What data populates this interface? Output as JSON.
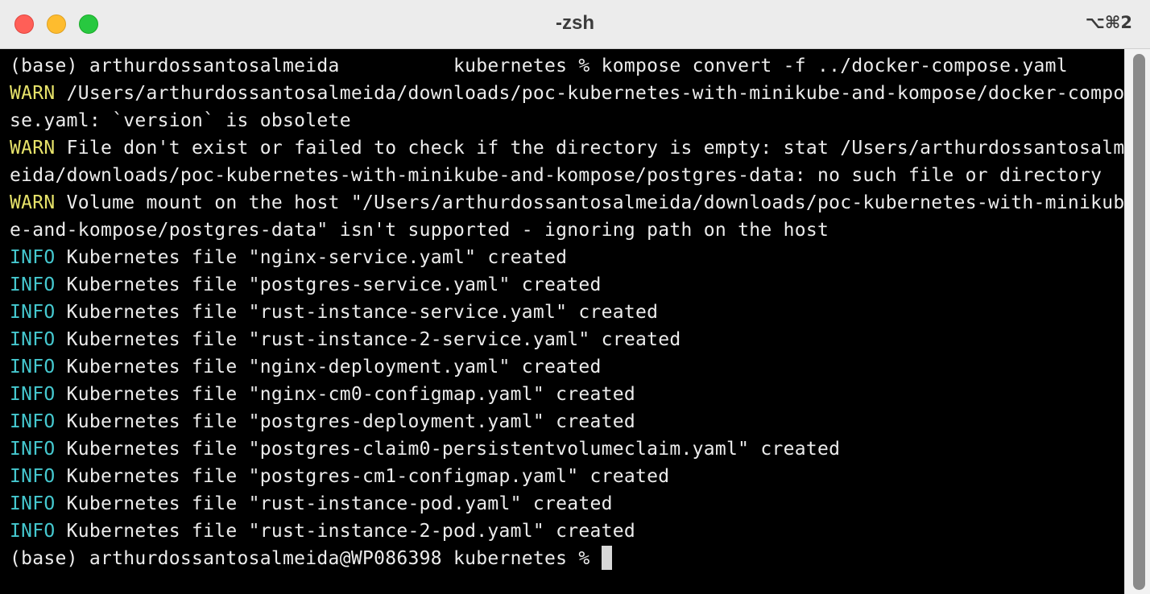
{
  "window": {
    "title": "-zsh",
    "shortcut": "⌥⌘2"
  },
  "terminal": {
    "lines": [
      {
        "tag": "",
        "text": "(base) arthurdossantosalmeida          kubernetes % kompose convert -f ../docker-compose.yaml"
      },
      {
        "tag": "WARN",
        "text": " /Users/arthurdossantosalmeida/downloads/poc-kubernetes-with-minikube-and-kompose/docker-compo"
      },
      {
        "tag": "",
        "text": "se.yaml: `version` is obsolete"
      },
      {
        "tag": "WARN",
        "text": " File don't exist or failed to check if the directory is empty: stat /Users/arthurdossantosalm"
      },
      {
        "tag": "",
        "text": "eida/downloads/poc-kubernetes-with-minikube-and-kompose/postgres-data: no such file or directory"
      },
      {
        "tag": "WARN",
        "text": " Volume mount on the host \"/Users/arthurdossantosalmeida/downloads/poc-kubernetes-with-minikub"
      },
      {
        "tag": "",
        "text": "e-and-kompose/postgres-data\" isn't supported - ignoring path on the host"
      },
      {
        "tag": "INFO",
        "text": " Kubernetes file \"nginx-service.yaml\" created"
      },
      {
        "tag": "INFO",
        "text": " Kubernetes file \"postgres-service.yaml\" created"
      },
      {
        "tag": "INFO",
        "text": " Kubernetes file \"rust-instance-service.yaml\" created"
      },
      {
        "tag": "INFO",
        "text": " Kubernetes file \"rust-instance-2-service.yaml\" created"
      },
      {
        "tag": "INFO",
        "text": " Kubernetes file \"nginx-deployment.yaml\" created"
      },
      {
        "tag": "INFO",
        "text": " Kubernetes file \"nginx-cm0-configmap.yaml\" created"
      },
      {
        "tag": "INFO",
        "text": " Kubernetes file \"postgres-deployment.yaml\" created"
      },
      {
        "tag": "INFO",
        "text": " Kubernetes file \"postgres-claim0-persistentvolumeclaim.yaml\" created"
      },
      {
        "tag": "INFO",
        "text": " Kubernetes file \"postgres-cm1-configmap.yaml\" created"
      },
      {
        "tag": "INFO",
        "text": " Kubernetes file \"rust-instance-pod.yaml\" created"
      },
      {
        "tag": "INFO",
        "text": " Kubernetes file \"rust-instance-2-pod.yaml\" created"
      }
    ],
    "prompt": "(base) arthurdossantosalmeida@WP086398 kubernetes % "
  },
  "colors": {
    "background": "#000000",
    "foreground": "#ececec",
    "warn": "#e7e36a",
    "info": "#45c8cf",
    "close": "#ff5f57",
    "minimize": "#febc2e",
    "maximize": "#28c840"
  },
  "icons": {
    "close": "close-button-icon",
    "minimize": "minimize-button-icon",
    "maximize": "maximize-button-icon",
    "cursor": "block-cursor"
  }
}
